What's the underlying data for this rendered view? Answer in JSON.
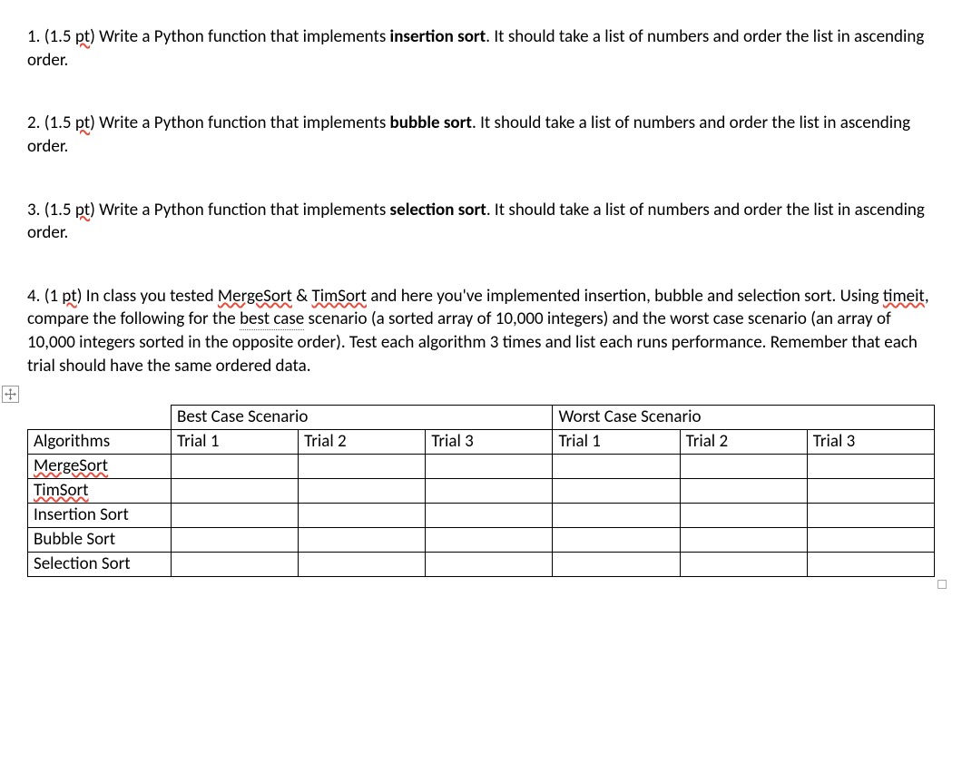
{
  "questions": {
    "q1_prefix": "1. (1.5 ",
    "q1_pt": "pt",
    "q1_after": ") Write a Python function that implements ",
    "q1_bold": "insertion sort",
    "q1_tail": ". It should take a list of numbers and order the list in ascending order.",
    "q2_prefix": "2. (1.5 ",
    "q2_pt": "pt",
    "q2_after": ") Write a Python function that implements ",
    "q2_bold": "bubble sort",
    "q2_tail": ". It should take a list of numbers and order the list in ascending order.",
    "q3_prefix": "3. (1.5 ",
    "q3_pt": "pt",
    "q3_after": ") Write a Python function that implements ",
    "q3_bold": "selection sort",
    "q3_tail": ". It should take a list of numbers and order the list in ascending order.",
    "q4_prefix": "4. (1 ",
    "q4_pt": "pt",
    "q4_a": ") In class you tested ",
    "q4_merge": "MergeSort",
    "q4_amp": " & ",
    "q4_tim": "TimSort",
    "q4_b": " and here you've implemented insertion, bubble and selection sort. Using ",
    "q4_timeit": "timeit",
    "q4_comma": ",",
    "q4_c": " compare the following for the ",
    "q4_best": "best case",
    "q4_d": " scenario (a sorted array of 10,000 integers) and the worst case scenario (an array of 10,000 integers sorted in the opposite order). Test each algorithm 3 times and list each runs performance. Remember that each trial should have the same ordered data."
  },
  "icons": {
    "plus": "✢"
  },
  "table": {
    "best_header": "Best Case Scenario",
    "worst_header": "Worst Case Scenario",
    "algorithms_label": "Algorithms",
    "trial1": "Trial 1",
    "trial2": "Trial 2",
    "trial3": "Trial 3",
    "rows": {
      "mergesort": "MergeSort",
      "timsort": "TimSort",
      "insertion": "Insertion Sort",
      "bubble": "Bubble Sort",
      "selection": "Selection Sort"
    }
  }
}
